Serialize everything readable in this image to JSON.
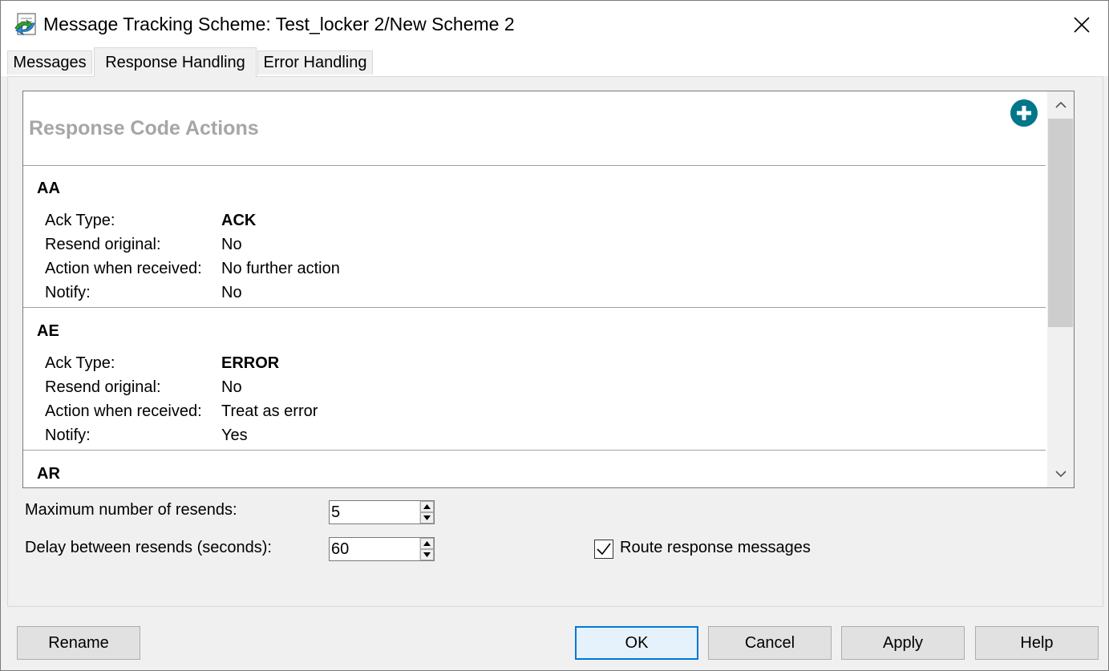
{
  "window": {
    "title": "Message Tracking Scheme: Test_locker 2/New Scheme 2",
    "close_icon": "close-icon",
    "app_icon": "message-tracking-icon"
  },
  "tabs": [
    {
      "label": "Messages",
      "active": false
    },
    {
      "label": "Response Handling",
      "active": true
    },
    {
      "label": "Error Handling",
      "active": false
    }
  ],
  "response_codes": {
    "title": "Response Code Actions",
    "add_icon": "add-circle-icon",
    "accent_color": "#00768a",
    "labels": {
      "ack_type": "Ack Type:",
      "resend": "Resend original:",
      "action": "Action when received:",
      "notify": "Notify:"
    },
    "entries": [
      {
        "code": "AA",
        "ack_type": "ACK",
        "resend": "No",
        "action": "No further action",
        "notify": "No"
      },
      {
        "code": "AE",
        "ack_type": "ERROR",
        "resend": "No",
        "action": "Treat as error",
        "notify": "Yes"
      },
      {
        "code": "AR",
        "ack_type": "",
        "resend": "",
        "action": "",
        "notify": ""
      }
    ]
  },
  "settings": {
    "max_resends_label": "Maximum number of resends:",
    "max_resends_value": "5",
    "delay_label": "Delay between resends (seconds):",
    "delay_value": "60",
    "route_label": "Route response messages",
    "route_checked": true
  },
  "buttons": {
    "rename": "Rename",
    "ok": "OK",
    "cancel": "Cancel",
    "apply": "Apply",
    "help": "Help"
  }
}
